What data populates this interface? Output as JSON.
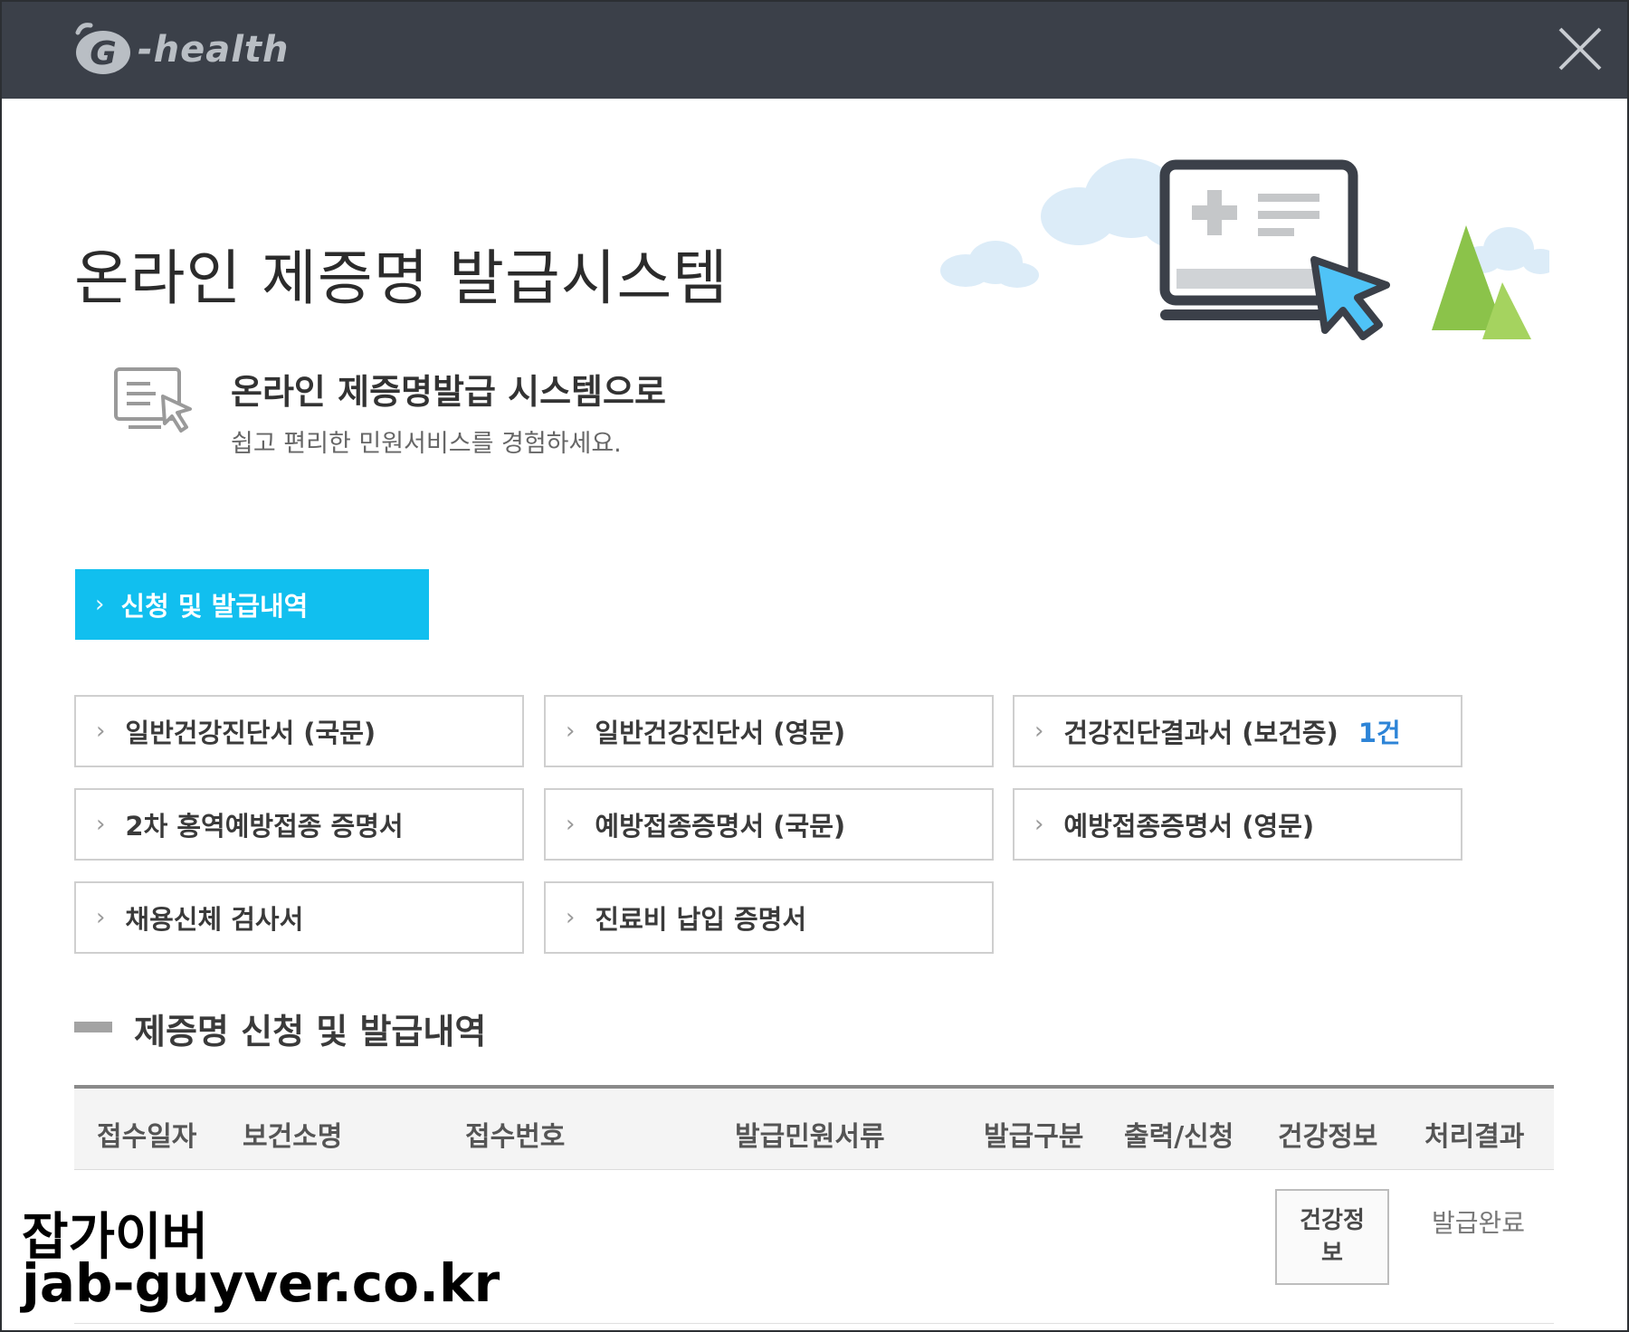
{
  "titlebar": {
    "logo_text": "-health",
    "close_icon": "close-icon"
  },
  "hero": {
    "title": "온라인 제증명 발급시스템",
    "illustration_icon": "laptop-medical-cursor-icon"
  },
  "intro": {
    "icon": "document-cursor-icon",
    "heading": "온라인 제증명발급 시스템으로",
    "subheading": "쉽고 편리한 민원서비스를 경험하세요."
  },
  "apply_button": {
    "chevron": "›",
    "label": "신청 및 발급내역"
  },
  "certificates": [
    {
      "label": "일반건강진단서 (국문)",
      "count": ""
    },
    {
      "label": "일반건강진단서 (영문)",
      "count": ""
    },
    {
      "label": "건강진단결과서 (보건증)",
      "count": "1건"
    },
    {
      "label": "2차 홍역예방접종 증명서",
      "count": ""
    },
    {
      "label": "예방접종증명서 (국문)",
      "count": ""
    },
    {
      "label": "예방접종증명서 (영문)",
      "count": ""
    },
    {
      "label": "채용신체 검사서",
      "count": ""
    },
    {
      "label": "진료비 납입 증명서",
      "count": ""
    }
  ],
  "history": {
    "title": "제증명 신청 및 발급내역",
    "columns": [
      "접수일자",
      "보건소명",
      "접수번호",
      "발급민원서류",
      "발급구분",
      "출력/신청",
      "건강정보",
      "처리결과"
    ],
    "rows": [
      {
        "health_info_button": "건강정보",
        "result": "발급완료"
      }
    ]
  },
  "watermark": {
    "line1": "잡가이버",
    "line2": "jab-guyver.co.kr"
  },
  "colors": {
    "titlebar": "#3b4049",
    "accent": "#11bfef",
    "count": "#2d84d7",
    "tree_green": "#8bc34a",
    "cursor_blue": "#4fc3f7"
  }
}
